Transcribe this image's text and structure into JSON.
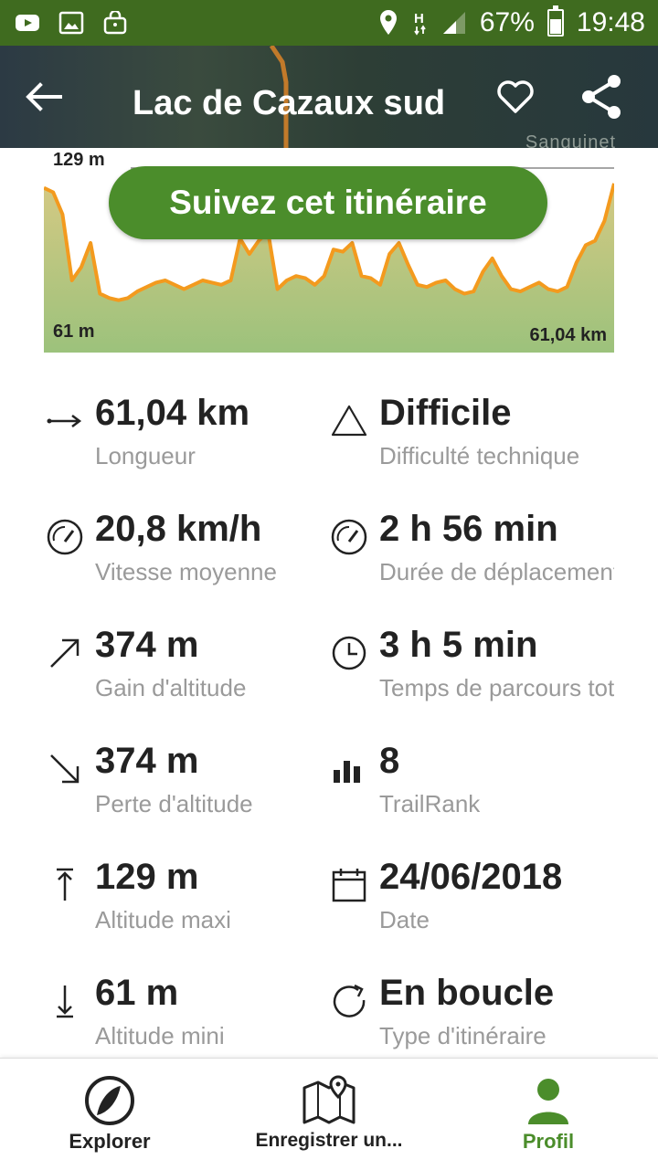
{
  "status_bar": {
    "battery": "67%",
    "time": "19:48",
    "icons": [
      "youtube-icon",
      "image-icon",
      "shopping-bag-icon",
      "location-icon",
      "h-network-icon",
      "signal-icon",
      "battery-icon"
    ],
    "battery_level": 0.67
  },
  "header": {
    "title": "Lac de Cazaux sud",
    "map_label": "Sanguinet",
    "icons": [
      "back-arrow-icon",
      "heart-icon",
      "share-icon"
    ]
  },
  "elevation": {
    "max_label": "129 m",
    "min_label": "61 m",
    "distance_label": "61,04 km",
    "button": "Suivez cet itinéraire",
    "line_color": "#f39a1e",
    "fill_top": "#c9c77e",
    "fill_bottom": "#8fbf73"
  },
  "chart_data": {
    "type": "area",
    "xlim": [
      0,
      61.04
    ],
    "ylim": [
      61,
      129
    ],
    "x_unit": "km",
    "y_unit": "m",
    "x": [
      0,
      1,
      2,
      3,
      4,
      5,
      6,
      7,
      8,
      9,
      10,
      11,
      12,
      13,
      14,
      15,
      16,
      17,
      18,
      19,
      20,
      21,
      22,
      23,
      24,
      25,
      26,
      27,
      28,
      29,
      30,
      31,
      32,
      33,
      34,
      35,
      36,
      37,
      38,
      39,
      40,
      41,
      42,
      43,
      44,
      45,
      46,
      47,
      48,
      49,
      50,
      51,
      52,
      53,
      54,
      55,
      56,
      57,
      58,
      59,
      60,
      61.04
    ],
    "y": [
      120,
      118,
      108,
      78,
      84,
      95,
      72,
      70,
      69,
      70,
      73,
      75,
      77,
      78,
      76,
      74,
      76,
      78,
      77,
      76,
      78,
      97,
      90,
      96,
      100,
      74,
      78,
      80,
      79,
      76,
      80,
      92,
      91,
      95,
      80,
      79,
      76,
      90,
      95,
      85,
      76,
      75,
      77,
      78,
      74,
      72,
      73,
      82,
      88,
      80,
      74,
      73,
      75,
      77,
      74,
      73,
      75,
      86,
      94,
      96,
      105,
      122
    ]
  },
  "stats": [
    {
      "icon": "distance-arrow-icon",
      "value": "61,04 km",
      "label": "Longueur"
    },
    {
      "icon": "difficulty-triangle-icon",
      "value": "Difficile",
      "label": "Difficulté technique"
    },
    {
      "icon": "speedometer-icon",
      "value": "20,8 km/h",
      "label": "Vitesse moyenne"
    },
    {
      "icon": "speedometer-icon",
      "value": "2 h 56 min",
      "label": "Durée de déplacement"
    },
    {
      "icon": "arrow-up-right-icon",
      "value": "374 m",
      "label": "Gain d'altitude"
    },
    {
      "icon": "clock-icon",
      "value": "3 h 5 min",
      "label": "Temps de parcours total"
    },
    {
      "icon": "arrow-down-right-icon",
      "value": "374 m",
      "label": "Perte d'altitude"
    },
    {
      "icon": "bar-chart-icon",
      "value": "8",
      "label": "TrailRank"
    },
    {
      "icon": "altitude-max-icon",
      "value": "129 m",
      "label": "Altitude maxi"
    },
    {
      "icon": "calendar-icon",
      "value": "24/06/2018",
      "label": "Date"
    },
    {
      "icon": "altitude-min-icon",
      "value": "61 m",
      "label": "Altitude mini"
    },
    {
      "icon": "loop-icon",
      "value": "En boucle",
      "label": "Type d'itinéraire"
    }
  ],
  "bottom_nav": {
    "explorer": "Explorer",
    "record": "Enregistrer un...",
    "profile": "Profil",
    "active_color": "#4b8d2b",
    "icons": [
      "explorer-logo-icon",
      "map-pin-icon",
      "profile-person-icon"
    ]
  }
}
